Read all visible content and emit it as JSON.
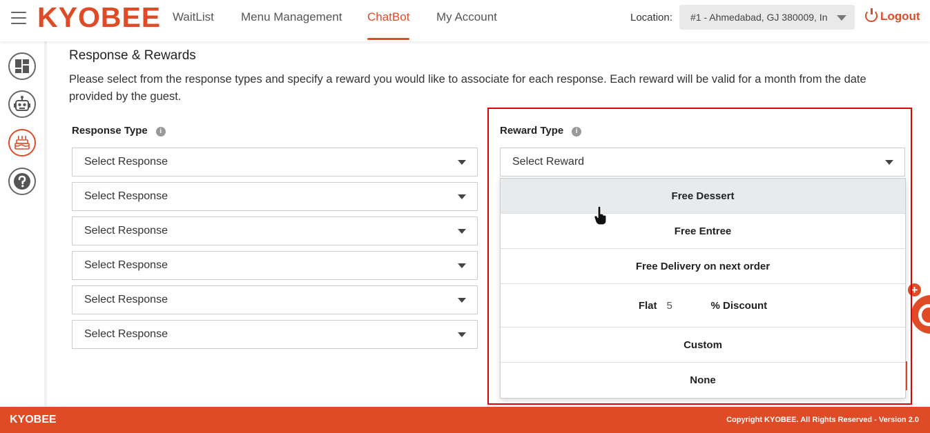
{
  "header": {
    "brand": "KYOBEE",
    "nav": [
      {
        "label": "WaitList",
        "active": false
      },
      {
        "label": "Menu Management",
        "active": false
      },
      {
        "label": "ChatBot",
        "active": true
      },
      {
        "label": "My Account",
        "active": false
      }
    ],
    "location_label": "Location:",
    "location_value": "#1 - Ahmedabad, GJ 380009, In",
    "logout_label": "Logout"
  },
  "sidebar": {
    "items": [
      {
        "icon": "dashboard-icon",
        "active": false
      },
      {
        "icon": "robot-icon",
        "active": false
      },
      {
        "icon": "cake-icon",
        "active": true
      },
      {
        "icon": "help-icon",
        "active": false
      }
    ]
  },
  "main": {
    "title": "Response & Rewards",
    "description": "Please select from the response types and specify a reward you would like to associate for each response. Each reward will be valid for a month from the date provided by the guest.",
    "response_type_label": "Response Type",
    "reward_type_label": "Reward Type",
    "info_glyph": "i",
    "response_selects": [
      "Select Response",
      "Select Response",
      "Select Response",
      "Select Response",
      "Select Response",
      "Select Response"
    ],
    "reward_select": "Select Reward",
    "reward_options": {
      "free_dessert": "Free Dessert",
      "free_entree": "Free Entree",
      "free_delivery": "Free Delivery on next order",
      "flat_prefix": "Flat",
      "flat_value": "5",
      "flat_suffix": "% Discount",
      "custom": "Custom",
      "none": "None"
    }
  },
  "footer": {
    "brand": "KYOBEE",
    "copyright": "Copyright KYOBEE. All Rights Reserved - Version 2.0"
  },
  "colors": {
    "accent": "#e04b27",
    "highlight": "#e00000"
  }
}
